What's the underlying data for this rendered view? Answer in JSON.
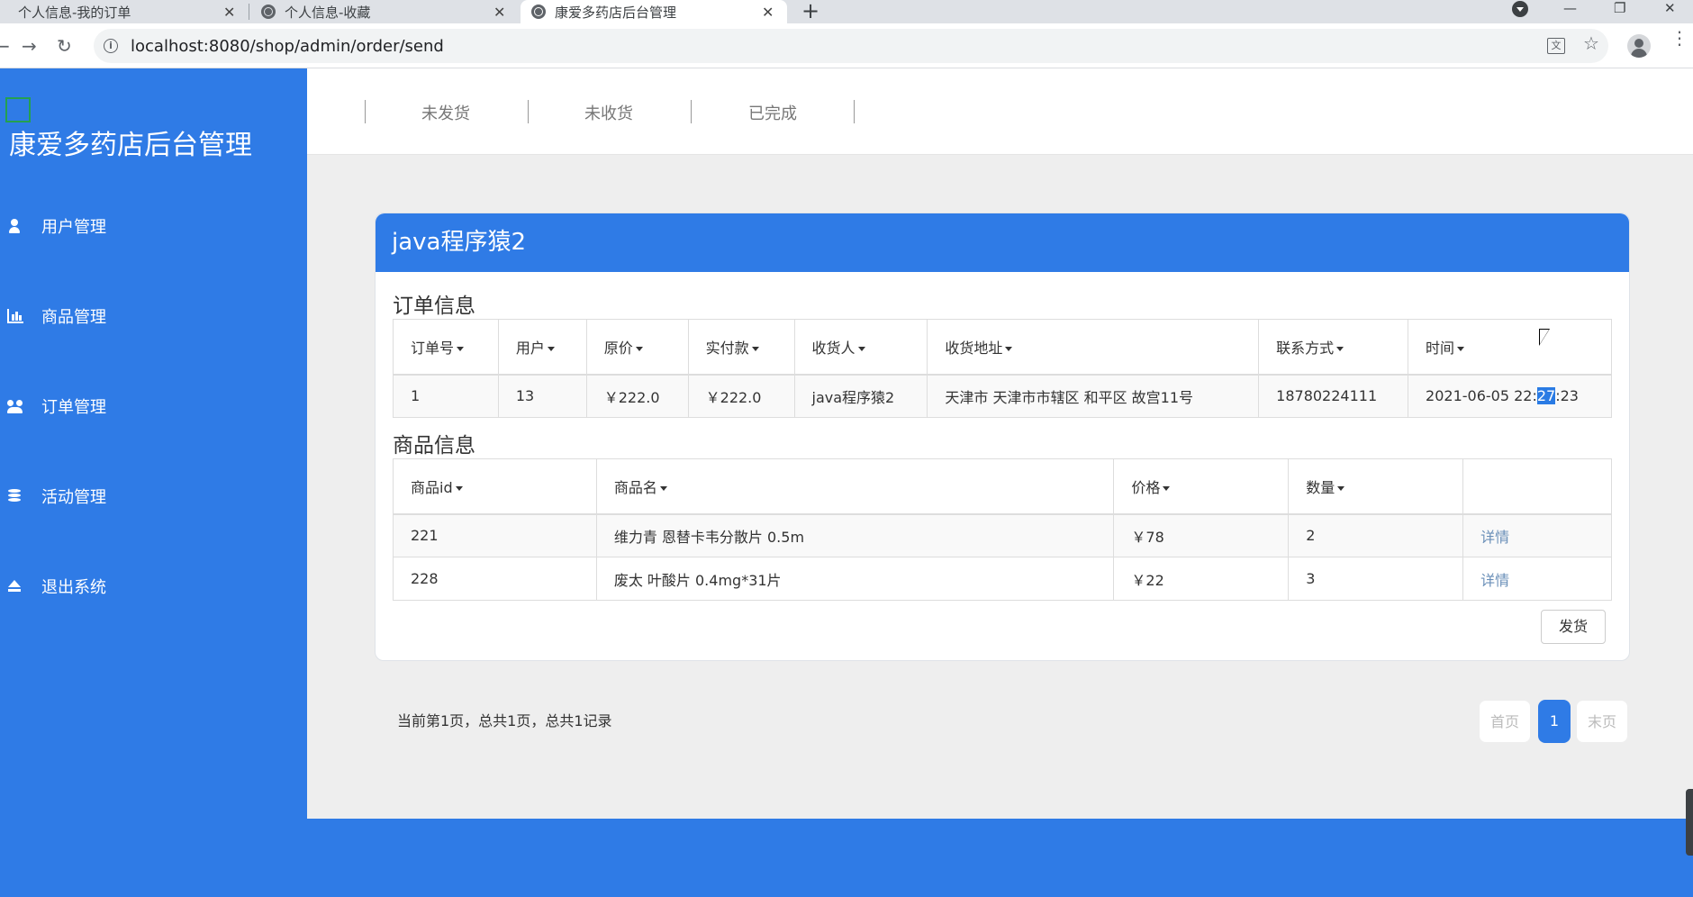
{
  "browser": {
    "tabs": [
      {
        "title": "个人信息-我的订单",
        "active": false
      },
      {
        "title": "个人信息-收藏",
        "active": false
      },
      {
        "title": "康爱多药店后台管理",
        "active": true
      }
    ],
    "tab_close": "✕",
    "new_tab": "+",
    "url": "localhost:8080/shop/admin/order/send",
    "window": {
      "minimize": "—",
      "maximize": "❐",
      "close": "✕"
    }
  },
  "sidebar": {
    "brand": "康爱多药店后台管理",
    "items": [
      {
        "label": "用户管理",
        "icon": "user-icon"
      },
      {
        "label": "商品管理",
        "icon": "bar-chart-icon"
      },
      {
        "label": "订单管理",
        "icon": "users-icon"
      },
      {
        "label": "活动管理",
        "icon": "database-icon"
      },
      {
        "label": "退出系统",
        "icon": "eject-icon"
      }
    ]
  },
  "topnav": {
    "items": [
      "未发货",
      "未收货",
      "已完成"
    ]
  },
  "panel": {
    "title": "java程序猿2",
    "order_section_title": "订单信息",
    "order_headers": [
      "订单号",
      "用户",
      "原价",
      "实付款",
      "收货人",
      "收货地址",
      "联系方式",
      "时间"
    ],
    "order_row": {
      "order_id": "1",
      "user": "13",
      "original_price": "￥222.0",
      "paid": "￥222.0",
      "receiver": "java程序猿2",
      "address": "天津市 天津市市辖区 和平区 故宫11号",
      "phone": "18780224111",
      "time_prefix": "2021-06-05 22:",
      "time_highlight": "27",
      "time_suffix": ":23"
    },
    "goods_section_title": "商品信息",
    "goods_headers": [
      "商品id",
      "商品名",
      "价格",
      "数量",
      ""
    ],
    "goods_rows": [
      {
        "id": "221",
        "name": "维力青 恩替卡韦分散片 0.5m",
        "price": "￥78",
        "qty": "2",
        "action": "详情"
      },
      {
        "id": "228",
        "name": "废太 叶酸片 0.4mg*31片",
        "price": "￥22",
        "qty": "3",
        "action": "详情"
      }
    ],
    "ship_button": "发货"
  },
  "pagination": {
    "info": "当前第1页，总共1页，总共1记录",
    "first": "首页",
    "current": "1",
    "last": "末页"
  },
  "colors": {
    "accent": "#2f7be6",
    "content_bg": "#eeeeee"
  }
}
